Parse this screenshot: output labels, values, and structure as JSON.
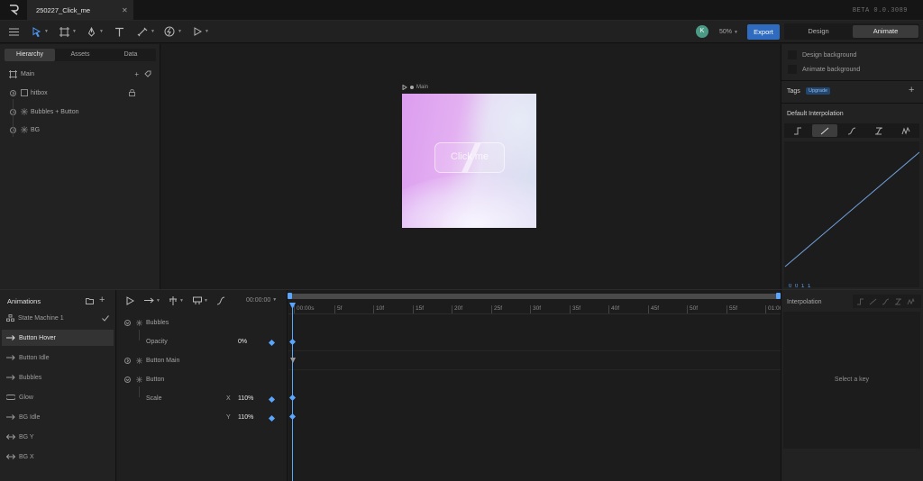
{
  "app": {
    "tab_title": "250227_Click_me",
    "tab_close": "✕",
    "version": "BETA 0.0.3089"
  },
  "toolbar": {
    "avatar_initial": "K",
    "zoom": "50%",
    "export_label": "Export",
    "mode_design": "Design",
    "mode_animate": "Animate"
  },
  "hierarchy": {
    "tabs": [
      "Hierarchy",
      "Assets",
      "Data"
    ],
    "root": "Main",
    "items": [
      {
        "label": "hitbox"
      },
      {
        "label": "Bubbles + Button"
      },
      {
        "label": "BG"
      }
    ],
    "add": "+"
  },
  "canvas": {
    "artboard_label": "Main",
    "button_text": "Click me"
  },
  "right": {
    "design_bg": "Design background",
    "animate_bg": "Animate background",
    "tags_label": "Tags",
    "upgrade": "Upgrade",
    "add": "+",
    "default_interp": "Default Interpolation",
    "curve_values": "0  0  1  1"
  },
  "animations": {
    "header": "Animations",
    "items": [
      {
        "label": "State Machine 1",
        "icon": "state-machine"
      },
      {
        "label": "Button Hover",
        "icon": "arrow"
      },
      {
        "label": "Button Idle",
        "icon": "arrow"
      },
      {
        "label": "Bubbles",
        "icon": "arrow"
      },
      {
        "label": "Glow",
        "icon": "loop"
      },
      {
        "label": "BG Idle",
        "icon": "arrow"
      },
      {
        "label": "BG Y",
        "icon": "pingpong"
      },
      {
        "label": "BG X",
        "icon": "pingpong"
      }
    ]
  },
  "props": {
    "timecode": "00:00:00",
    "rows": {
      "bubbles": "Bubbles",
      "opacity": "Opacity",
      "opacity_val": "0%",
      "button_main": "Button Main",
      "button": "Button",
      "scale": "Scale",
      "x": "X",
      "x_val": "110%",
      "y": "Y",
      "y_val": "110%"
    }
  },
  "timeline": {
    "ticks": [
      "00:00s",
      "5f",
      "10f",
      "15f",
      "20f",
      "25f",
      "30f",
      "35f",
      "40f",
      "45f",
      "50f",
      "55f",
      "01:00"
    ]
  },
  "interp_panel": {
    "title": "Interpolation",
    "empty": "Select a key"
  },
  "colors": {
    "accent": "#2f6cc0",
    "keyframe": "#5aa6ff",
    "curve": "#6f9fd8"
  }
}
